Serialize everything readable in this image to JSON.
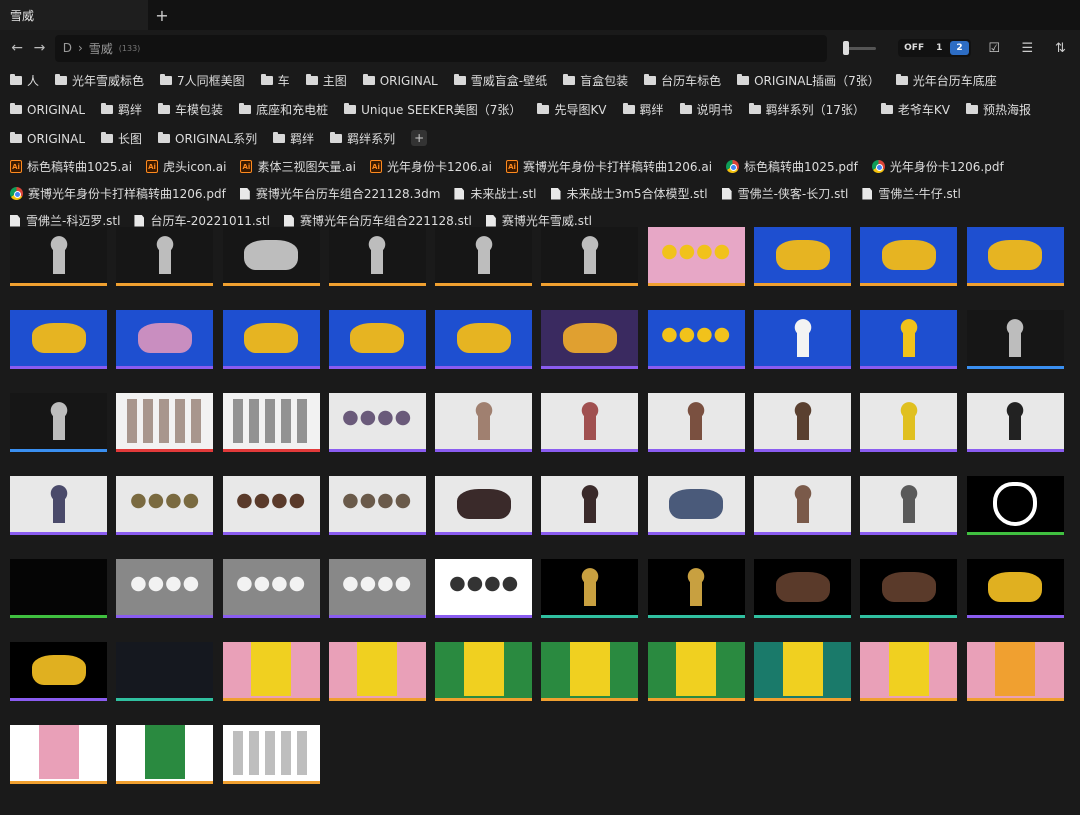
{
  "tab": {
    "title": "雪威",
    "add_label": "+"
  },
  "toolbar": {
    "back": "←",
    "forward": "→",
    "path_drive": "D",
    "path_sep": "›",
    "path_folder": "雪威",
    "path_count": "(133)",
    "toggle_off": "OFF",
    "toggle_opt1": "1",
    "toggle_opt2": "2",
    "check_icon": "☑",
    "sort_icon": "☰",
    "swap_icon": "⇅"
  },
  "folders": [
    "人",
    "光年雪威标色",
    "7人同框美图",
    "车",
    "主图",
    "ORIGINAL",
    "雪威盲盒-壁纸",
    "盲盒包装",
    "台历车标色",
    "ORIGINAL插画（7张）",
    "光年台历车底座",
    "ORIGINAL",
    "羁绊",
    "车模包装",
    "底座和充电桩",
    "Unique SEEKER美图（7张）",
    "先导图KV",
    "羁绊",
    "说明书",
    "羁绊系列（17张）",
    "老爷车KV",
    "预热海报",
    "ORIGINAL",
    "长图",
    "ORIGINAL系列",
    "羁绊",
    "羁绊系列"
  ],
  "files": [
    {
      "type": "ai",
      "name": "标色稿转曲1025.ai"
    },
    {
      "type": "ai",
      "name": "虎头icon.ai"
    },
    {
      "type": "ai",
      "name": "素体三视图矢量.ai"
    },
    {
      "type": "ai",
      "name": "光年身份卡1206.ai"
    },
    {
      "type": "ai",
      "name": "赛博光年身份卡打样稿转曲1206.ai"
    },
    {
      "type": "pdf",
      "name": "标色稿转曲1025.pdf"
    },
    {
      "type": "pdf",
      "name": "光年身份卡1206.pdf"
    },
    {
      "type": "pdf",
      "name": "赛博光年身份卡打样稿转曲1206.pdf"
    },
    {
      "type": "doc",
      "name": "赛博光年台历车组合221128.3dm"
    },
    {
      "type": "doc",
      "name": "未来战士.stl"
    },
    {
      "type": "doc",
      "name": "未来战士3m5合体模型.stl"
    },
    {
      "type": "doc",
      "name": "雪佛兰-侠客-长刀.stl"
    },
    {
      "type": "doc",
      "name": "雪佛兰-牛仔.stl"
    },
    {
      "type": "doc",
      "name": "雪佛兰-科迈罗.stl"
    },
    {
      "type": "doc",
      "name": "台历车-20221011.stl"
    },
    {
      "type": "doc",
      "name": "赛博光年台历车组合221128.stl"
    },
    {
      "type": "doc",
      "name": "赛博光年雪威.stl"
    }
  ],
  "thumbs": [
    {
      "bg": "#161616",
      "fg": "#bdbdbd",
      "bar": "#f0a030",
      "shape": "fig"
    },
    {
      "bg": "#161616",
      "fg": "#bdbdbd",
      "bar": "#f0a030",
      "shape": "fig"
    },
    {
      "bg": "#161616",
      "fg": "#bdbdbd",
      "bar": "#f0a030",
      "shape": "car"
    },
    {
      "bg": "#161616",
      "fg": "#bdbdbd",
      "bar": "#f0a030",
      "shape": "fig"
    },
    {
      "bg": "#161616",
      "fg": "#bdbdbd",
      "bar": "#f0a030",
      "shape": "fig"
    },
    {
      "bg": "#161616",
      "fg": "#bdbdbd",
      "bar": "#f0a030",
      "shape": "fig"
    },
    {
      "bg": "#e7a7c6",
      "fg": "#f1c21b",
      "bar": "#f0a030",
      "shape": "group"
    },
    {
      "bg": "#1e4fd0",
      "fg": "#e6b422",
      "bar": "#f0a030",
      "shape": "car"
    },
    {
      "bg": "#1e4fd0",
      "fg": "#e6b422",
      "bar": "#f0a030",
      "shape": "car"
    },
    {
      "bg": "#1e4fd0",
      "fg": "#e6b422",
      "bar": "#f0a030",
      "shape": "car"
    },
    {
      "bg": "#1e4fd0",
      "fg": "#e6b422",
      "bar": "#8a5cf0",
      "shape": "car"
    },
    {
      "bg": "#1e4fd0",
      "fg": "#c98ec0",
      "bar": "#8a5cf0",
      "shape": "car"
    },
    {
      "bg": "#1e4fd0",
      "fg": "#e6b422",
      "bar": "#8a5cf0",
      "shape": "car"
    },
    {
      "bg": "#1e4fd0",
      "fg": "#e6b422",
      "bar": "#8a5cf0",
      "shape": "car"
    },
    {
      "bg": "#1e4fd0",
      "fg": "#e6b422",
      "bar": "#8a5cf0",
      "shape": "car"
    },
    {
      "bg": "#3a2a60",
      "fg": "#e0a030",
      "bar": "#8a5cf0",
      "shape": "car"
    },
    {
      "bg": "#1e4fd0",
      "fg": "#f1c21b",
      "bar": "#8a5cf0",
      "shape": "group"
    },
    {
      "bg": "#1e4fd0",
      "fg": "#f3f3f3",
      "bar": "#8a5cf0",
      "shape": "fig"
    },
    {
      "bg": "#1e4fd0",
      "fg": "#f1c21b",
      "bar": "#8a5cf0",
      "shape": "fig"
    },
    {
      "bg": "#161616",
      "fg": "#bdbdbd",
      "bar": "#3a8ff0",
      "shape": "fig"
    },
    {
      "bg": "#161616",
      "fg": "#bdbdbd",
      "bar": "#3a8ff0",
      "shape": "fig"
    },
    {
      "bg": "#f2f2f2",
      "fg": "#6b4a3a",
      "bar": "#e23a3a",
      "shape": "doc"
    },
    {
      "bg": "#f2f2f2",
      "fg": "#444",
      "bar": "#e23a3a",
      "shape": "doc"
    },
    {
      "bg": "#e8e8e8",
      "fg": "#6a5a7a",
      "bar": "#8a5cf0",
      "shape": "group"
    },
    {
      "bg": "#e8e8e8",
      "fg": "#a08070",
      "bar": "#8a5cf0",
      "shape": "fig"
    },
    {
      "bg": "#e8e8e8",
      "fg": "#a05050",
      "bar": "#8a5cf0",
      "shape": "fig"
    },
    {
      "bg": "#e8e8e8",
      "fg": "#7a5040",
      "bar": "#8a5cf0",
      "shape": "fig"
    },
    {
      "bg": "#e8e8e8",
      "fg": "#5a4030",
      "bar": "#8a5cf0",
      "shape": "fig"
    },
    {
      "bg": "#e8e8e8",
      "fg": "#e0c020",
      "bar": "#8a5cf0",
      "shape": "fig"
    },
    {
      "bg": "#e8e8e8",
      "fg": "#222",
      "bar": "#8a5cf0",
      "shape": "fig"
    },
    {
      "bg": "#e8e8e8",
      "fg": "#4a4a6a",
      "bar": "#8a5cf0",
      "shape": "fig"
    },
    {
      "bg": "#e8e8e8",
      "fg": "#7a6a40",
      "bar": "#8a5cf0",
      "shape": "group"
    },
    {
      "bg": "#e8e8e8",
      "fg": "#5a3a2a",
      "bar": "#8a5cf0",
      "shape": "group"
    },
    {
      "bg": "#e8e8e8",
      "fg": "#6a5a4a",
      "bar": "#8a5cf0",
      "shape": "group"
    },
    {
      "bg": "#e8e8e8",
      "fg": "#3a2a2a",
      "bar": "#8a5cf0",
      "shape": "car"
    },
    {
      "bg": "#e8e8e8",
      "fg": "#3a2a2a",
      "bar": "#8a5cf0",
      "shape": "fig"
    },
    {
      "bg": "#e8e8e8",
      "fg": "#4a5a7a",
      "bar": "#8a5cf0",
      "shape": "car"
    },
    {
      "bg": "#e8e8e8",
      "fg": "#7a5a4a",
      "bar": "#8a5cf0",
      "shape": "fig"
    },
    {
      "bg": "#e8e8e8",
      "fg": "#5a5a5a",
      "bar": "#8a5cf0",
      "shape": "fig"
    },
    {
      "bg": "#000000",
      "fg": "#ffffff",
      "bar": "#40c040",
      "shape": "tiger"
    },
    {
      "bg": "#050505",
      "fg": "#050505",
      "bar": "#40c040",
      "shape": "none"
    },
    {
      "bg": "#888888",
      "fg": "#f2f2f2",
      "bar": "#8a5cf0",
      "shape": "group"
    },
    {
      "bg": "#888888",
      "fg": "#f2f2f2",
      "bar": "#8a5cf0",
      "shape": "group"
    },
    {
      "bg": "#888888",
      "fg": "#f2f2f2",
      "bar": "#8a5cf0",
      "shape": "group"
    },
    {
      "bg": "#ffffff",
      "fg": "#333",
      "bar": "#8a5cf0",
      "shape": "group"
    },
    {
      "bg": "#000000",
      "fg": "#c8a040",
      "bar": "#30c0a0",
      "shape": "fig"
    },
    {
      "bg": "#000000",
      "fg": "#c8a040",
      "bar": "#30c0a0",
      "shape": "fig"
    },
    {
      "bg": "#000000",
      "fg": "#5a3a2a",
      "bar": "#30c0a0",
      "shape": "car"
    },
    {
      "bg": "#000000",
      "fg": "#5a3a2a",
      "bar": "#30c0a0",
      "shape": "car"
    },
    {
      "bg": "#000000",
      "fg": "#e0b020",
      "bar": "#8a5cf0",
      "shape": "car"
    },
    {
      "bg": "#000000",
      "fg": "#e0b020",
      "bar": "#8a5cf0",
      "shape": "car"
    },
    {
      "bg": "#15181f",
      "fg": "#15181f",
      "bar": "#30c0a0",
      "shape": "none"
    },
    {
      "bg": "#e9a0b8",
      "fg": "#f0d020",
      "bar": "#f0a030",
      "shape": "poster"
    },
    {
      "bg": "#e9a0b8",
      "fg": "#f0d020",
      "bar": "#f0a030",
      "shape": "poster"
    },
    {
      "bg": "#2a8a40",
      "fg": "#f0d020",
      "bar": "#f0a030",
      "shape": "poster"
    },
    {
      "bg": "#2a8a40",
      "fg": "#f0d020",
      "bar": "#f0a030",
      "shape": "poster"
    },
    {
      "bg": "#2a8a40",
      "fg": "#f0d020",
      "bar": "#f0a030",
      "shape": "poster"
    },
    {
      "bg": "#1a7a6a",
      "fg": "#f0d020",
      "bar": "#f0a030",
      "shape": "poster"
    },
    {
      "bg": "#e9a0b8",
      "fg": "#f0d020",
      "bar": "#f0a030",
      "shape": "poster"
    },
    {
      "bg": "#e9a0b8",
      "fg": "#f0a030",
      "bar": "#f0a030",
      "shape": "poster"
    },
    {
      "bg": "#ffffff",
      "fg": "#e9a0b8",
      "bar": "#f0a030",
      "shape": "poster"
    },
    {
      "bg": "#ffffff",
      "fg": "#2a8a40",
      "bar": "#f0a030",
      "shape": "poster"
    },
    {
      "bg": "#ffffff",
      "fg": "#888",
      "bar": "#f0a030",
      "shape": "doc"
    }
  ]
}
